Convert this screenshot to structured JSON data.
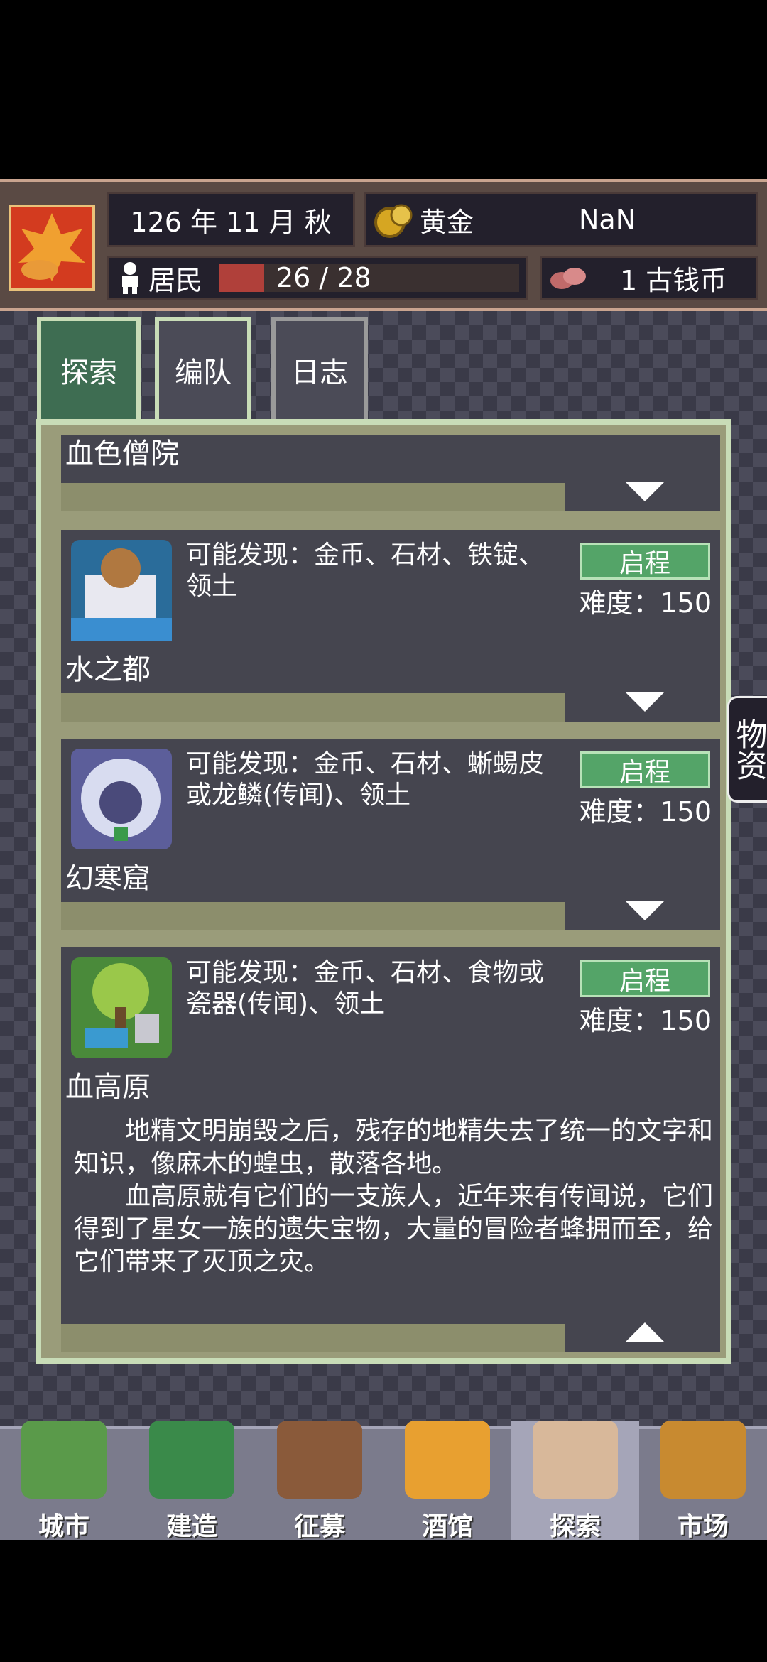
{
  "hud": {
    "date": "126 年 11 月 秋",
    "gold_label": "黄金",
    "gold_value": "NaN",
    "residents_label": "居民",
    "residents_value": "26 / 28",
    "residents_fill_ratio": 0.15,
    "coins": "1 古钱币"
  },
  "tabs": [
    {
      "label": "探索"
    },
    {
      "label": "编队"
    },
    {
      "label": "日志"
    }
  ],
  "locations": [
    {
      "name": "血色僧院"
    },
    {
      "name": "水之都",
      "finds": "可能发现：金币、石材、铁锭、领土",
      "button": "启程",
      "difficulty": "难度：150"
    },
    {
      "name": "幻寒窟",
      "finds": "可能发现：金币、石材、蜥蜴皮或龙鳞(传闻)、领土",
      "button": "启程",
      "difficulty": "难度：150"
    },
    {
      "name": "血高原",
      "finds": "可能发现：金币、石材、食物或瓷器(传闻)、领土",
      "button": "启程",
      "difficulty": "难度：150",
      "story_p1": "　　地精文明崩毁之后，残存的地精失去了统一的文字和知识，像麻木的蝗虫，散落各地。",
      "story_p2": "　　血高原就有它们的一支族人，近年来有传闻说，它们得到了星女一族的遗失宝物，大量的冒险者蜂拥而至，给它们带来了灭顶之灾。"
    }
  ],
  "side_tab": {
    "label": "物资"
  },
  "nav": [
    {
      "label": "城市"
    },
    {
      "label": "建造"
    },
    {
      "label": "征募"
    },
    {
      "label": "酒馆"
    },
    {
      "label": "探索"
    },
    {
      "label": "市场"
    }
  ]
}
